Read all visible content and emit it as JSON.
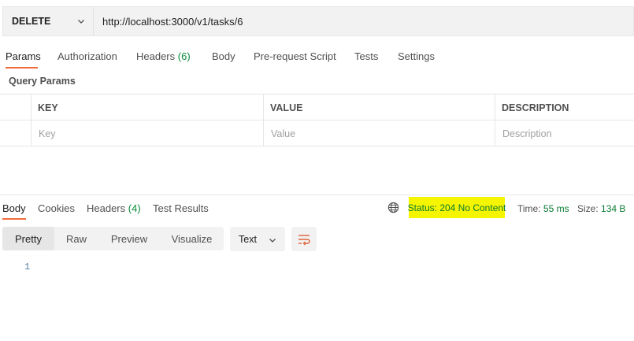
{
  "request": {
    "method": "DELETE",
    "url": "http://localhost:3000/v1/tasks/6"
  },
  "request_tabs": {
    "params": "Params",
    "authorization": "Authorization",
    "headers": "Headers",
    "headers_count": "(6)",
    "body": "Body",
    "prerequest": "Pre-request Script",
    "tests": "Tests",
    "settings": "Settings"
  },
  "query_params": {
    "title": "Query Params",
    "columns": {
      "key": "KEY",
      "value": "VALUE",
      "description": "DESCRIPTION"
    },
    "placeholders": {
      "key": "Key",
      "value": "Value",
      "description": "Description"
    }
  },
  "response_tabs": {
    "body": "Body",
    "cookies": "Cookies",
    "headers": "Headers",
    "headers_count": "(4)",
    "test_results": "Test Results"
  },
  "response_meta": {
    "status": "Status: 204 No Content",
    "time_label": "Time:",
    "time_value": "55 ms",
    "size_label": "Size:",
    "size_value": "134 B",
    "highlight_color": "#f5f500",
    "status_color": "#0a7a33"
  },
  "view_modes": {
    "pretty": "Pretty",
    "raw": "Raw",
    "preview": "Preview",
    "visualize": "Visualize",
    "selected": "pretty"
  },
  "format": {
    "selected": "Text"
  },
  "editor": {
    "line_number": "1"
  },
  "colors": {
    "accent": "#f26b3a",
    "count_green": "#0a8a3a"
  },
  "icons": {
    "method_dropdown": "chevron-down-icon",
    "network": "globe-icon",
    "format_dropdown": "chevron-down-icon",
    "wrap": "wrap-lines-icon"
  }
}
